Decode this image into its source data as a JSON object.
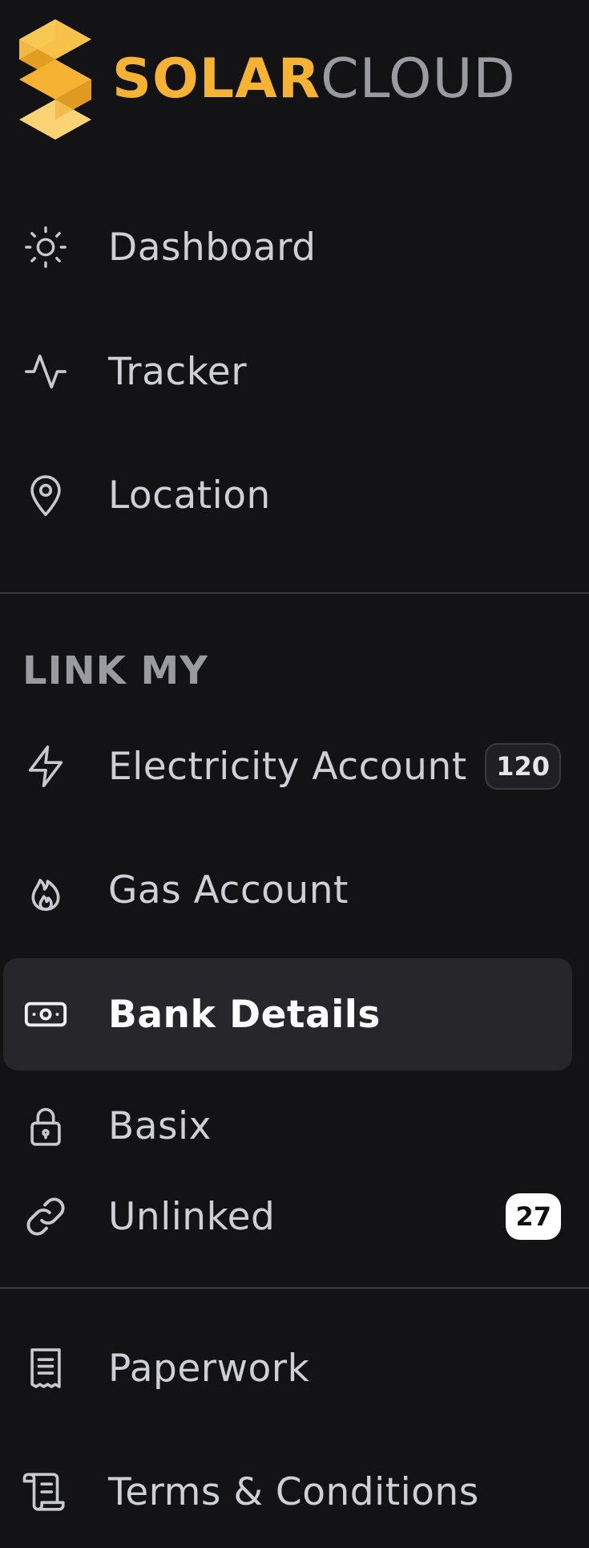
{
  "brand": {
    "name_part1": "SOLAR",
    "name_part2": "CLOUD",
    "accent_color": "#f5b233",
    "secondary_color": "#9a9aa1"
  },
  "nav": {
    "primary": [
      {
        "label": "Dashboard",
        "icon": "sun-icon"
      },
      {
        "label": "Tracker",
        "icon": "activity-pulse-icon"
      },
      {
        "label": "Location",
        "icon": "map-pin-icon"
      }
    ],
    "section_title": "LINK MY",
    "link_items": [
      {
        "label": "Electricity Account",
        "icon": "lightning-bolt-icon",
        "badge": "120"
      },
      {
        "label": "Gas Account",
        "icon": "flame-icon"
      },
      {
        "label": "Bank Details",
        "icon": "banknote-icon",
        "active": true
      },
      {
        "label": "Basix",
        "icon": "lock-icon"
      },
      {
        "label": "Unlinked",
        "icon": "link-icon",
        "badge": "27"
      }
    ],
    "secondary": [
      {
        "label": "Paperwork",
        "icon": "receipt-icon"
      },
      {
        "label": "Terms & Conditions",
        "icon": "scroll-icon"
      }
    ]
  },
  "colors": {
    "background": "#131316",
    "active_bg": "#27272b",
    "divider": "#3a3a40"
  }
}
